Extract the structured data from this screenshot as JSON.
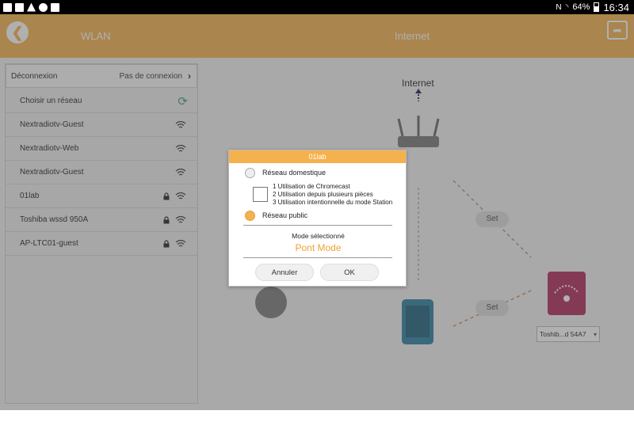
{
  "status_bar": {
    "battery": "64%",
    "time": "16:34"
  },
  "app_bar": {
    "left_title": "WLAN",
    "center_title": "Internet"
  },
  "sidebar": {
    "disconnect": {
      "label": "Déconnexion",
      "status": "Pas de connexion"
    },
    "choose_label": "Choisir un réseau",
    "networks": [
      {
        "name": "Nextradiotv-Guest",
        "locked": false
      },
      {
        "name": "Nextradiotv-Web",
        "locked": false
      },
      {
        "name": "Nextradiotv-Guest",
        "locked": false
      },
      {
        "name": "01lab",
        "locked": true
      },
      {
        "name": "Toshiba wssd 950A",
        "locked": true
      },
      {
        "name": "AP-LTC01-guest",
        "locked": true
      }
    ]
  },
  "diagram": {
    "internet_label": "Internet",
    "set_labels": [
      "Set",
      "Set"
    ],
    "device_select": "Toshib...d 54A7"
  },
  "dialog": {
    "title": "01lab",
    "option_home": "Réseau domestique",
    "uses": [
      "1 Utilisation de Chromecast",
      "2 Utilisation depuis plusieurs pièces",
      "3 Utilisation intentionnelle du mode Station"
    ],
    "option_public": "Réseau public",
    "mode_label": "Mode sélectionné",
    "mode_value": "Pont Mode",
    "cancel": "Annuler",
    "ok": "OK"
  },
  "colors": {
    "accent": "#f5b14e",
    "router_card": "#b0285a",
    "phone": "#2a7fa0"
  }
}
